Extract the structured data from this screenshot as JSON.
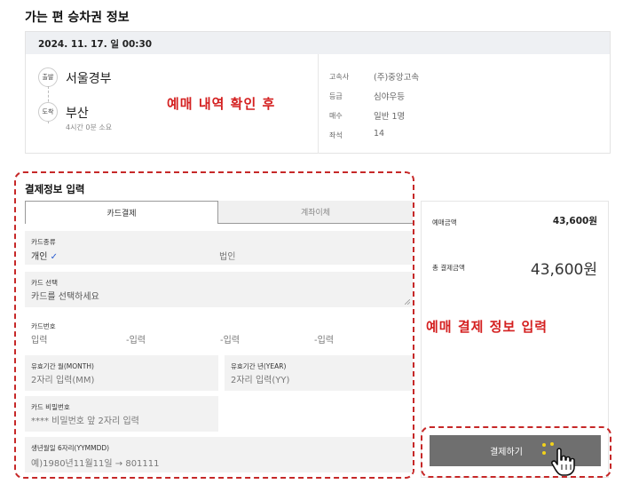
{
  "section_title": "가는 편 승차권 정보",
  "ticket": {
    "datetime": "2024. 11. 17. 일 00:30",
    "departure_badge": "출발",
    "departure": "서울경부",
    "arrival_badge": "도착",
    "arrival": "부산",
    "duration": "4시간 0분 소요",
    "info": [
      {
        "label": "고속사",
        "value": "(주)중앙고속"
      },
      {
        "label": "등급",
        "value": "심야우등"
      },
      {
        "label": "매수",
        "value": "일반 1명"
      },
      {
        "label": "좌석",
        "value": "14"
      }
    ]
  },
  "annotations": {
    "reservation_check": "예매 내역 확인 후",
    "payment_input": "예매 결제 정보 입력"
  },
  "payment": {
    "title": "결제정보 입력",
    "tabs": [
      "카드결제",
      "계좌이체"
    ],
    "card_type": {
      "label": "카드종류",
      "personal": "개인",
      "check": "✓",
      "corporate": "법인"
    },
    "card_select": {
      "label": "카드 선택",
      "placeholder": "카드를 선택하세요"
    },
    "card_number": {
      "label": "카드번호",
      "parts": [
        "입력",
        "-입력",
        "-입력",
        "-입력"
      ]
    },
    "expiry_month": {
      "label": "유효기간 월(MONTH)",
      "placeholder": "2자리 입력(MM)"
    },
    "expiry_year": {
      "label": "유효기간 년(YEAR)",
      "placeholder": "2자리 입력(YY)"
    },
    "card_password": {
      "label": "카드 비밀번호",
      "placeholder": "**** 비밀번호 앞 2자리 입력"
    },
    "birth": {
      "label": "생년월일 6자리(YYMMDD)",
      "placeholder": "예)1980년11월11일 → 801111"
    }
  },
  "summary": {
    "reserved_amount_label": "예매금액",
    "reserved_amount": "43,600원",
    "total_label": "총 결제금액",
    "total_amount": "43,600원"
  },
  "pay_button_label": "결제하기",
  "colors": {
    "annotation": "#d42020",
    "button": "#6f6f6f",
    "tab_border": "#999999",
    "field_bg": "#f2f2f2"
  },
  "icons": [
    "check-icon",
    "pointer-hand-icon",
    "click-sparkle-icon"
  ]
}
